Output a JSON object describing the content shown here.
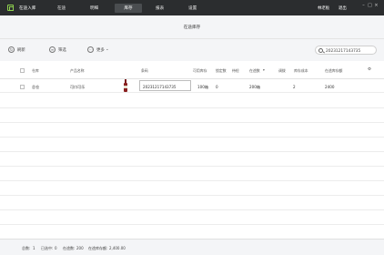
{
  "app": {
    "brand": "在途入库",
    "nav": [
      "在途",
      "明细",
      "库存",
      "报表",
      "设置"
    ],
    "active_nav": "库存",
    "user": "林老板",
    "logout": "退出"
  },
  "page": {
    "title": "在途库存"
  },
  "toolbar": {
    "refresh_label": "刷新",
    "filter_label": "筛选",
    "more_label": "更多",
    "search_value": "20231217143735"
  },
  "table": {
    "columns": [
      "仓库",
      "产品名称",
      "",
      "条码",
      "可用库存",
      "锁定数",
      "待检",
      "在途数",
      "调拨",
      "库存成本",
      "在途库存额"
    ],
    "rows": [
      {
        "warehouse": "总仓",
        "product": "可口可乐",
        "barcode": "20231217143735",
        "available": "100箱",
        "locked": "0",
        "pending": "",
        "in_transit": "200箱",
        "transfer": "",
        "cost": "2",
        "transit_amount": "2400"
      }
    ]
  },
  "footer": {
    "count_label": "总数:",
    "count": "1",
    "selected_label": "已选中:",
    "selected": "0",
    "transit_qty_label": "在途数:",
    "transit_qty": "200",
    "transit_amount_label": "在途库存额:",
    "transit_amount": "2,400.00"
  },
  "colors": {
    "topbar": "#2b2d2f",
    "panel": "#f4f5f7",
    "logo": "#8fd14f"
  }
}
